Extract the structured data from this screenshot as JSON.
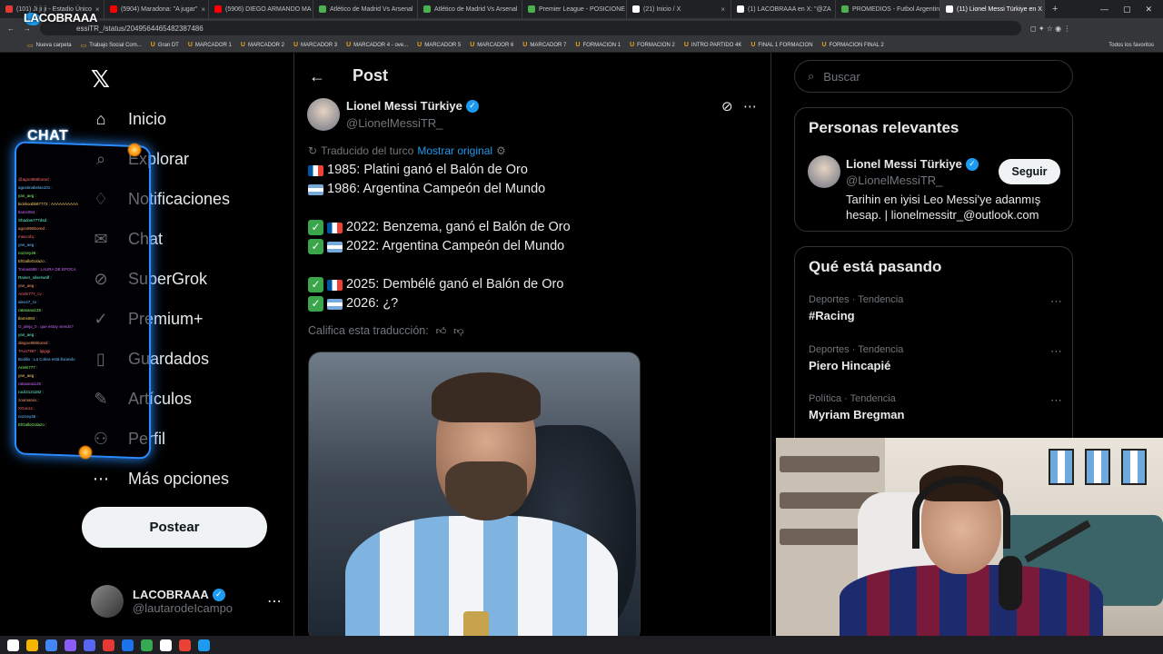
{
  "browser": {
    "tabs": [
      {
        "label": "(101) Ji ji ji - Estadio Único",
        "color": "#e53935"
      },
      {
        "label": "(5904) Maradona: \"A jugar\"",
        "color": "#ff0000"
      },
      {
        "label": "(5906) DIEGO ARMANDO MA",
        "color": "#ff0000"
      },
      {
        "label": "Atlético de Madrid Vs Arsenal",
        "color": "#4caf50"
      },
      {
        "label": "Atlético de Madrid Vs Arsenal",
        "color": "#4caf50"
      },
      {
        "label": "Premier League - POSICIONE",
        "color": "#4caf50"
      },
      {
        "label": "(21) Inicio / X",
        "color": "#ffffff"
      },
      {
        "label": "(1) LACOBRAAA en X: \"@ZA",
        "color": "#ffffff"
      },
      {
        "label": "PROMEDIOS - Futbol Argentin",
        "color": "#4caf50"
      },
      {
        "label": "(11) Lionel Messi Türkiye en X",
        "color": "#ffffff"
      }
    ],
    "url": "essiTR_/status/2049564465482387486",
    "stream_logo": "LACOBRAAA",
    "bookmarks": [
      "Nueva carpeta",
      "Trabajo Social Com...",
      "Gran DT",
      "MARCADOR 1",
      "MARCADOR 2",
      "MARCADOR 3",
      "MARCADOR 4 - ove...",
      "MARCADOR 5",
      "MARCADOR 6",
      "MARCADOR 7",
      "FORMACION 1",
      "FORMACION 2",
      "INTRO PARTIDO 4K",
      "FINAL 1 FORMACION",
      "FORMACION FINAL 2"
    ],
    "bookmarks_right": "Todos los favoritos"
  },
  "sidebar": {
    "logo": "𝕏",
    "items": [
      {
        "label": "Inicio",
        "icon": "⌂"
      },
      {
        "label": "Explorar",
        "icon": "⌕"
      },
      {
        "label": "Notificaciones",
        "icon": "♢"
      },
      {
        "label": "Chat",
        "icon": "✉"
      },
      {
        "label": "SuperGrok",
        "icon": "⊘"
      },
      {
        "label": "Premium+",
        "icon": "✓"
      },
      {
        "label": "Guardados",
        "icon": "▯"
      },
      {
        "label": "Artículos",
        "icon": "✎"
      },
      {
        "label": "Perfil",
        "icon": "⚇"
      },
      {
        "label": "Más opciones",
        "icon": "⋯"
      }
    ],
    "post_button": "Postear",
    "account": {
      "name": "LACOBRAAA",
      "handle": "@lautarodeIcampo"
    }
  },
  "chat_overlay": {
    "title": "CHAT",
    "lines": [
      "@agoo956bored :",
      "agustinabelas101 :",
      "yan_aeg :",
      "kickkoobb87772 : AAAAAAAAAA",
      "tlams084 :",
      "Shadow777dsd :",
      "agoo956bored :",
      "maxcobj :",
      "yan_aeg :",
      "nozzey46 :",
      "ElGalloGolazo :",
      "Tomas588 : LAURA DE EPOCA",
      "Rainer_silverwolf :",
      "yan_aeg :",
      "Ariels777_cv :",
      "alex47_cv :",
      "ratasana125 :",
      "tlams084 :",
      "O_alejo_0 : que estoy viendo?",
      "yan_aeg :",
      "diegoo956bored :",
      "TAxs7997 : lgigigi",
      "Bodilix : La Cobra está llorando",
      "Ariels777 :",
      "yan_aeg :",
      "ratasana125 :",
      "rocil2121182 :",
      "zoomarxis :",
      "XGonzx :",
      "nozzey46 :",
      "ElGalloGolazo :"
    ]
  },
  "main": {
    "title": "Post",
    "author": {
      "name": "Lionel Messi Türkiye",
      "handle": "@LionelMessiTR_"
    },
    "translated_label": "Traducido del turco",
    "show_original": "Mostrar original",
    "lines": [
      {
        "check": false,
        "flag": "fr",
        "text": "1985: Platini ganó el Balón de Oro"
      },
      {
        "check": false,
        "flag": "ar",
        "text": "1986: Argentina Campeón del Mundo"
      },
      {
        "gap": true
      },
      {
        "check": true,
        "flag": "fr",
        "text": "2022: Benzema, ganó el Balón de Oro"
      },
      {
        "check": true,
        "flag": "ar",
        "text": "2022: Argentina Campeón del Mundo"
      },
      {
        "gap": true
      },
      {
        "check": true,
        "flag": "fr",
        "text": "2025: Dembélé ganó el Balón de Oro"
      },
      {
        "check": true,
        "flag": "ar",
        "text": "2026: ¿?"
      }
    ],
    "rate_label": "Califica esta traducción:"
  },
  "right": {
    "search_placeholder": "Buscar",
    "relevant_title": "Personas relevantes",
    "relevant": {
      "name": "Lionel Messi Türkiye",
      "handle": "@LionelMessiTR_",
      "follow": "Seguir",
      "bio": "Tarihin en iyisi Leo Messi'ye adanmış hesap. | lionelmessitr_@outlook.com"
    },
    "trends_title": "Qué está pasando",
    "trends": [
      {
        "meta": "Deportes · Tendencia",
        "name": "#Racing"
      },
      {
        "meta": "Deportes · Tendencia",
        "name": "Piero Hincapié"
      },
      {
        "meta": "Política · Tendencia",
        "name": "Myriam Bregman"
      }
    ]
  },
  "colors": {
    "accent": "#1d9bf0",
    "check": "#3aa54a",
    "chat_glow": "#2b8cff"
  }
}
